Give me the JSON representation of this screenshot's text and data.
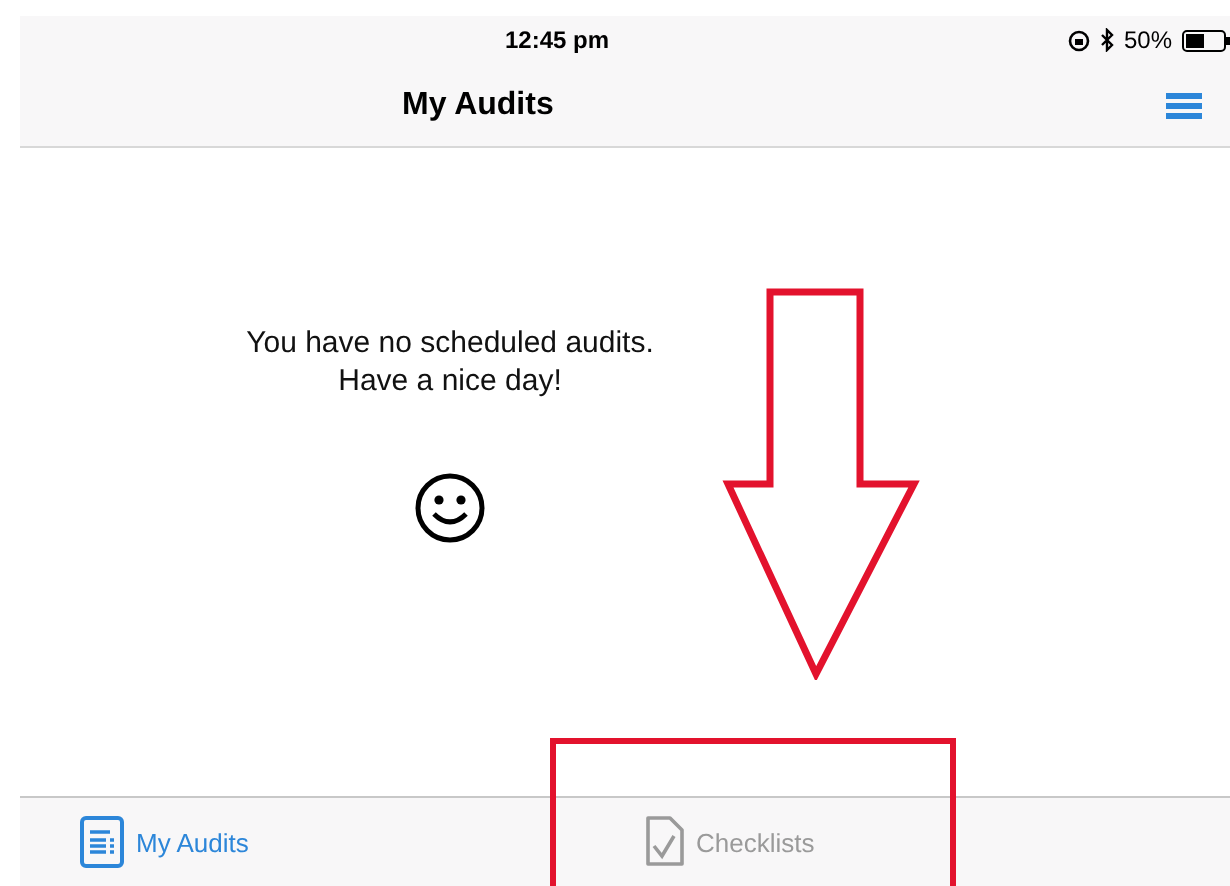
{
  "status_bar": {
    "time": "12:45 pm",
    "battery": "50%"
  },
  "nav_bar": {
    "title": "My Audits"
  },
  "empty_state": {
    "lines": [
      "You have no scheduled audits.",
      "Have a nice day!"
    ]
  },
  "tabs": [
    {
      "label": "My Audits",
      "selected": true,
      "kind": "document"
    },
    {
      "label": "Checklists",
      "selected": false,
      "kind": "checklist"
    }
  ]
}
